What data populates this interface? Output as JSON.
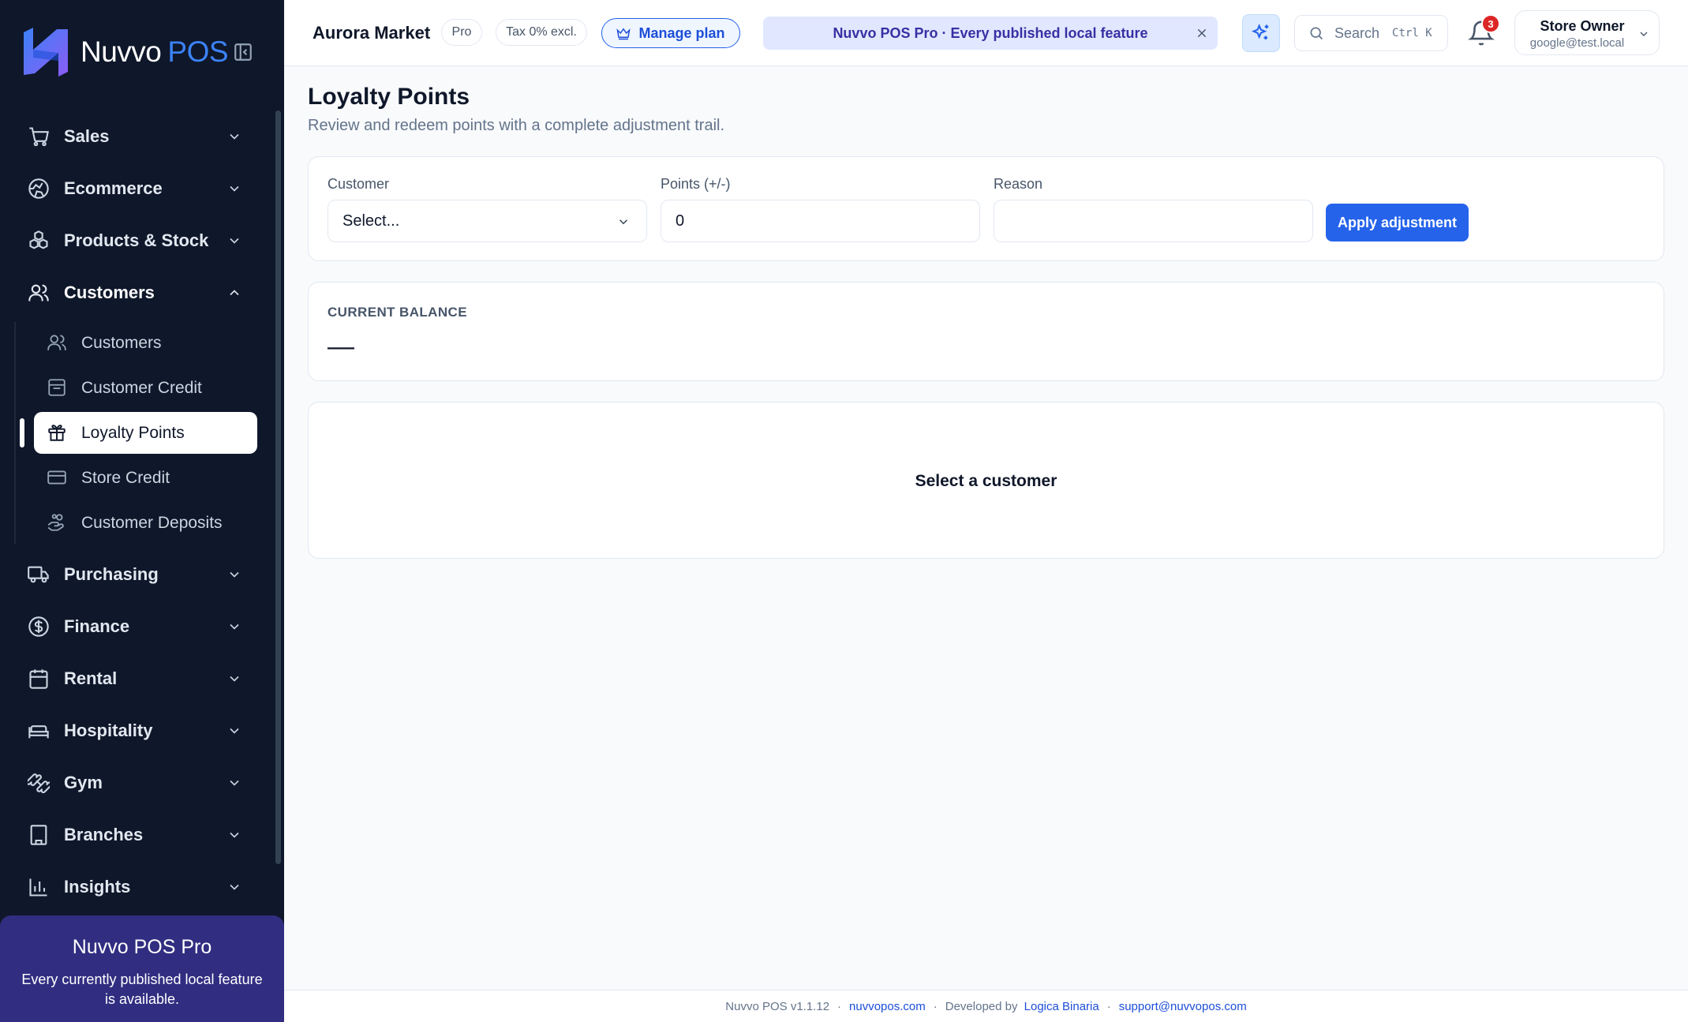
{
  "brand": {
    "name": "Nuvvo",
    "suffix": "POS",
    "accent": "#3b82f6"
  },
  "sidebar": {
    "items": [
      {
        "label": "Sales",
        "icon": "cart-icon",
        "expanded": false
      },
      {
        "label": "Ecommerce",
        "icon": "globe-icon",
        "expanded": false
      },
      {
        "label": "Products & Stock",
        "icon": "boxes-icon",
        "expanded": false
      },
      {
        "label": "Customers",
        "icon": "users-icon",
        "expanded": true
      },
      {
        "label": "Purchasing",
        "icon": "truck-icon",
        "expanded": false
      },
      {
        "label": "Finance",
        "icon": "dollar-circle-icon",
        "expanded": false
      },
      {
        "label": "Rental",
        "icon": "calendar-icon",
        "expanded": false
      },
      {
        "label": "Hospitality",
        "icon": "bed-icon",
        "expanded": false
      },
      {
        "label": "Gym",
        "icon": "dumbbell-icon",
        "expanded": false
      },
      {
        "label": "Branches",
        "icon": "building-icon",
        "expanded": false
      },
      {
        "label": "Insights",
        "icon": "bar-chart-icon",
        "expanded": false
      }
    ],
    "customers_sub": [
      {
        "label": "Customers",
        "icon": "users-icon"
      },
      {
        "label": "Customer Credit",
        "icon": "receipt-icon"
      },
      {
        "label": "Loyalty Points",
        "icon": "gift-icon",
        "active": true
      },
      {
        "label": "Store Credit",
        "icon": "credit-card-icon"
      },
      {
        "label": "Customer Deposits",
        "icon": "hand-coins-icon"
      }
    ],
    "promo": {
      "title": "Nuvvo POS Pro",
      "text": "Every currently published local feature is available."
    }
  },
  "topbar": {
    "store_name": "Aurora Market",
    "plan_pill": "Pro",
    "tax_pill": "Tax 0% excl.",
    "manage_plan": "Manage plan",
    "banner": "Nuvvo POS Pro · Every published local feature",
    "search_placeholder": "Search",
    "search_shortcut": "Ctrl K",
    "notification_count": "3",
    "user": {
      "name": "Store Owner",
      "email": "google@test.local"
    }
  },
  "page": {
    "title": "Loyalty Points",
    "subtitle": "Review and redeem points with a complete adjustment trail.",
    "form": {
      "customer_label": "Customer",
      "customer_value": "Select...",
      "points_label": "Points (+/-)",
      "points_value": "0",
      "reason_label": "Reason",
      "reason_value": "",
      "apply_label": "Apply adjustment"
    },
    "balance": {
      "label": "CURRENT BALANCE",
      "value": "—"
    },
    "history": {
      "empty": "Select a customer"
    }
  },
  "footer": {
    "version": "Nuvvo POS v1.1.12",
    "site": "nuvvopos.com",
    "developed_by": "Developed by",
    "developer": "Logica Binaria",
    "support": "support@nuvvopos.com"
  },
  "colors": {
    "sidebar_bg": "#0f172a",
    "primary": "#2563eb",
    "promo_bg": "#312e81",
    "badge": "#dc2626"
  }
}
